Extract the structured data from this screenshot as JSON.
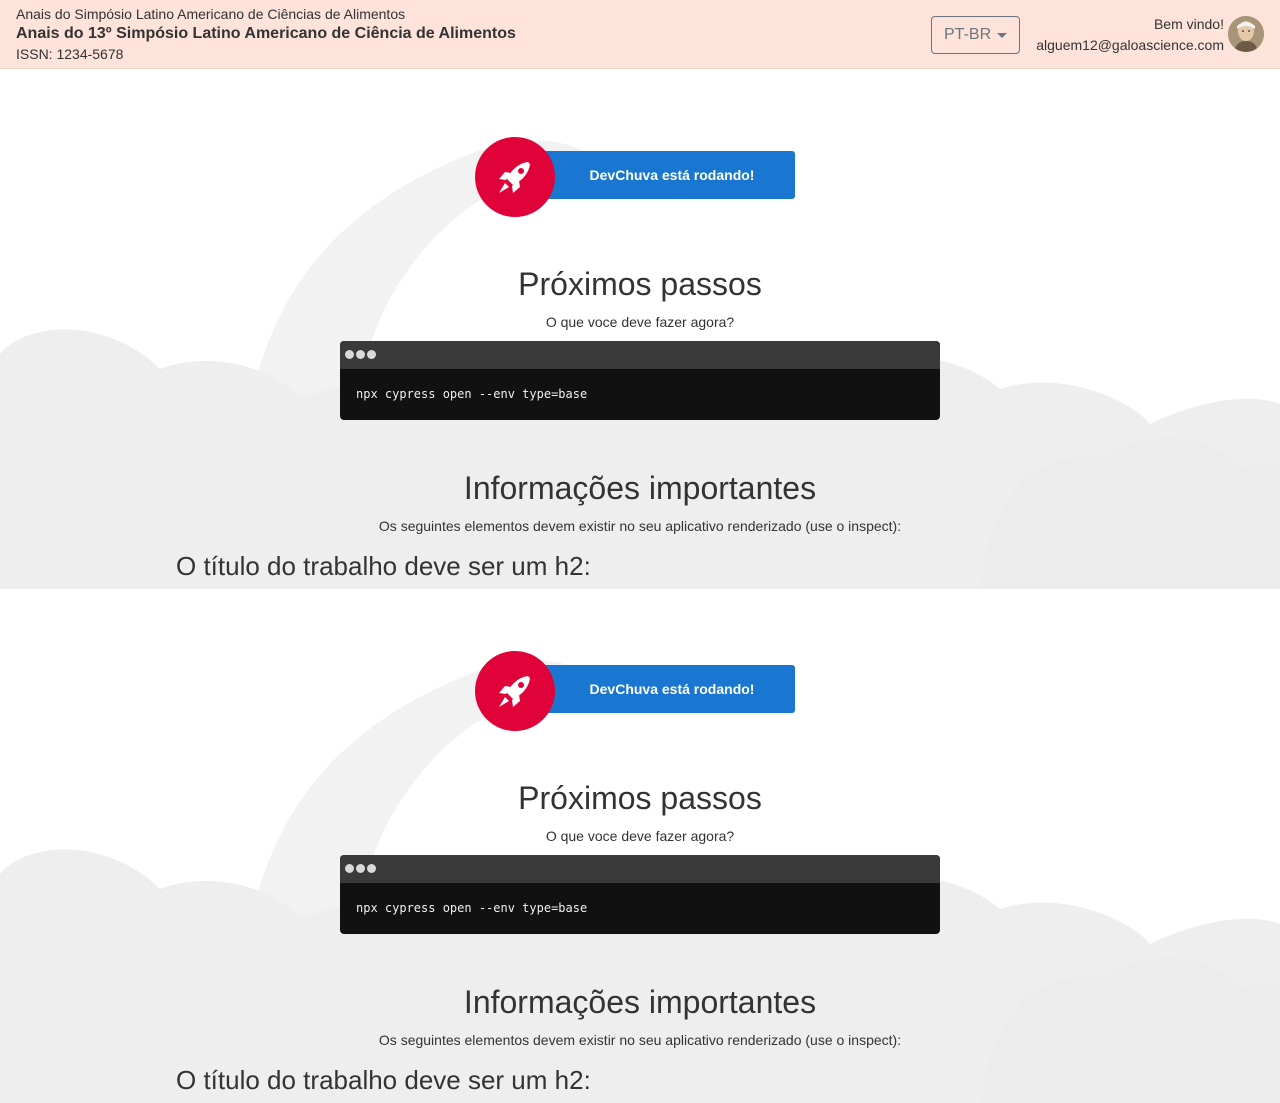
{
  "header": {
    "event_name": "Anais do Simpósio Latino Americano de Ciências de Alimentos",
    "edition_title": "Anais do 13º Simpósio Latino Americano de Ciência de Alimentos",
    "issn": "ISSN: 1234-5678",
    "language_button": "PT-BR",
    "welcome": "Bem vindo!",
    "email": "alguem12@galoascience.com"
  },
  "sections": [
    {
      "status_label": "DevChuva está rodando!",
      "next_steps_title": "Próximos passos",
      "next_steps_subtitle": "O que voce deve fazer agora?",
      "command": "npx cypress open --env type=base",
      "info_title": "Informações importantes",
      "info_subtitle": "Os seguintes elementos devem existir no seu aplicativo renderizado (use o inspect):",
      "requirement_heading": "O título do trabalho deve ser um h2:"
    },
    {
      "status_label": "DevChuva está rodando!",
      "next_steps_title": "Próximos passos",
      "next_steps_subtitle": "O que voce deve fazer agora?",
      "command": "npx cypress open --env type=base",
      "info_title": "Informações importantes",
      "info_subtitle": "Os seguintes elementos devem existir no seu aplicativo renderizado (use o inspect):",
      "requirement_heading": "O título do trabalho deve ser um h2:"
    }
  ],
  "colors": {
    "header_bg": "#fde3da",
    "status_blue": "#1977d1",
    "rocket_red": "#e0033a",
    "terminal_bg": "#111111",
    "terminal_bar": "#3a3a3a"
  },
  "icons": {
    "rocket": "rocket-icon",
    "language_caret": "caret-down-icon",
    "terminal_dots": "window-dots-icon"
  }
}
